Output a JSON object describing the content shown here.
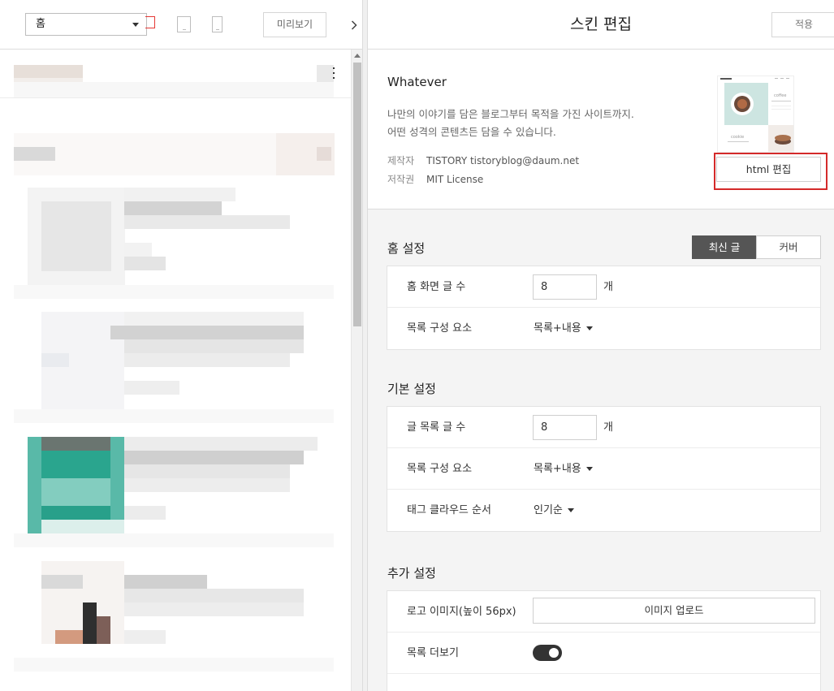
{
  "toolbar": {
    "page_select_value": "홈",
    "preview_label": "미리보기",
    "collapse_glyph": "›"
  },
  "panel": {
    "title": "스킨 편집",
    "apply_label": "적용"
  },
  "skin": {
    "name": "Whatever",
    "description_line1": "나만의 이야기를 담은 블로그부터 목적을 가진 사이트까지.",
    "description_line2": "어떤 성격의 콘텐츠든 담을 수 있습니다.",
    "author_label": "제작자",
    "author_value": "TISTORY  tistoryblog@daum.net",
    "license_label": "저작권",
    "license_value": "MIT License",
    "html_edit_label": "html 편집",
    "thumb_text_coffee": "coffee",
    "thumb_text_cookie": "cookie"
  },
  "home_settings": {
    "title": "홈 설정",
    "tab_latest": "최신 글",
    "tab_cover": "커버",
    "rows": {
      "post_count_label": "홈 화면 글 수",
      "post_count_value": "8",
      "post_count_unit": "개",
      "list_elements_label": "목록 구성 요소",
      "list_elements_value": "목록+내용"
    }
  },
  "basic_settings": {
    "title": "기본 설정",
    "rows": {
      "list_count_label": "글 목록 글 수",
      "list_count_value": "8",
      "list_count_unit": "개",
      "list_elements_label": "목록 구성 요소",
      "list_elements_value": "목록+내용",
      "tag_order_label": "태그 클라우드 순서",
      "tag_order_value": "인기순"
    }
  },
  "extra_settings": {
    "title": "추가 설정",
    "rows": {
      "logo_label": "로고 이미지(높이 56px)",
      "logo_upload_label": "이미지 업로드",
      "more_label": "목록 더보기",
      "more_enabled": true
    }
  },
  "colors": {
    "accent_red": "#d42a2a",
    "segment_active": "#555555",
    "toggle_on": "#333333"
  }
}
